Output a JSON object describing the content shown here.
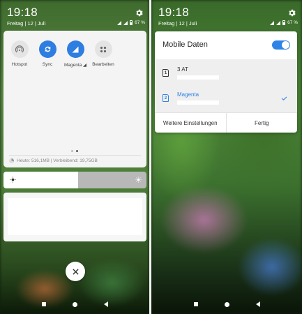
{
  "left": {
    "status": {
      "time": "19:18",
      "date": "Freitag | 12 | Juli",
      "battery": "67 %"
    },
    "tiles": [
      {
        "label": "Hotspot",
        "icon": "hotspot-icon",
        "active": false
      },
      {
        "label": "Sync",
        "icon": "sync-icon",
        "active": true
      },
      {
        "label": "Magenta",
        "icon": "signal-icon",
        "active": true
      },
      {
        "label": "Bearbeiten",
        "icon": "grid-icon",
        "active": false
      }
    ],
    "data_usage": "Heute: 516,1MB | Verbleibend: 19,75GB",
    "brightness_level": 0.52
  },
  "right": {
    "status": {
      "time": "19:18",
      "date": "Freitag | 12 | Juli",
      "battery": "67 %"
    },
    "dialog": {
      "title": "Mobile Daten",
      "toggle_on": true,
      "sims": [
        {
          "slot": "1",
          "name": "3 AT",
          "selected": false
        },
        {
          "slot": "2",
          "name": "Magenta",
          "selected": true
        }
      ],
      "buttons": {
        "more": "Weitere Einstellungen",
        "done": "Fertig"
      }
    }
  },
  "colors": {
    "accent": "#2f83e6"
  }
}
